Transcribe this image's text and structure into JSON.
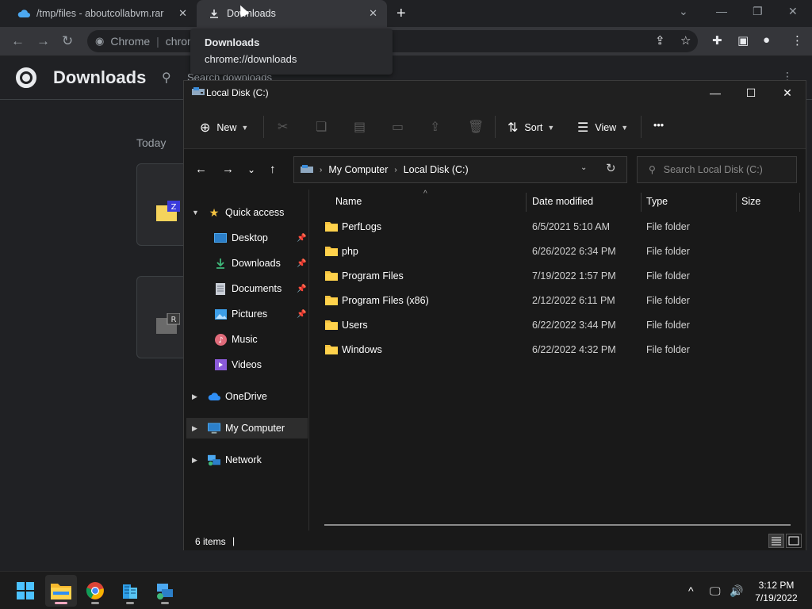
{
  "chrome": {
    "tabs": [
      {
        "label": "/tmp/files - aboutcollabvm.rar",
        "icon": "cloud-icon"
      },
      {
        "label": "Downloads",
        "icon": "download-icon"
      }
    ],
    "omnibox": {
      "site_label": "Chrome",
      "url_partial": "chrom"
    },
    "tooltip": {
      "title": "Downloads",
      "url": "chrome://downloads"
    },
    "downloads_page": {
      "title": "Downloads",
      "search_placeholder": "Search downloads",
      "section_label": "Today"
    }
  },
  "explorer": {
    "title": "Local Disk (C:)",
    "commands": {
      "new_label": "New",
      "sort_label": "Sort",
      "view_label": "View",
      "more_label": "•••"
    },
    "breadcrumb": [
      "My Computer",
      "Local Disk (C:)"
    ],
    "search_placeholder": "Search Local Disk (C:)",
    "nav": [
      {
        "label": "Quick access",
        "icon": "star-icon"
      },
      {
        "label": "Desktop",
        "icon": "desktop-icon",
        "pinned": true
      },
      {
        "label": "Downloads",
        "icon": "download-icon",
        "pinned": true
      },
      {
        "label": "Documents",
        "icon": "document-icon",
        "pinned": true
      },
      {
        "label": "Pictures",
        "icon": "pictures-icon",
        "pinned": true
      },
      {
        "label": "Music",
        "icon": "music-icon"
      },
      {
        "label": "Videos",
        "icon": "videos-icon"
      },
      {
        "label": "OneDrive",
        "icon": "cloud-icon"
      },
      {
        "label": "My Computer",
        "icon": "computer-icon",
        "selected": true
      },
      {
        "label": "Network",
        "icon": "network-icon"
      }
    ],
    "columns": [
      "Name",
      "Date modified",
      "Type",
      "Size"
    ],
    "rows": [
      {
        "name": "PerfLogs",
        "date": "6/5/2021 5:10 AM",
        "type": "File folder"
      },
      {
        "name": "php",
        "date": "6/26/2022 6:34 PM",
        "type": "File folder"
      },
      {
        "name": "Program Files",
        "date": "7/19/2022 1:57 PM",
        "type": "File folder"
      },
      {
        "name": "Program Files (x86)",
        "date": "2/12/2022 6:11 PM",
        "type": "File folder"
      },
      {
        "name": "Users",
        "date": "6/22/2022 3:44 PM",
        "type": "File folder"
      },
      {
        "name": "Windows",
        "date": "6/22/2022 4:32 PM",
        "type": "File folder"
      }
    ],
    "status": {
      "item_count": "6 items"
    }
  },
  "taskbar": {
    "apps": [
      "start-icon",
      "file-explorer-icon",
      "chrome-icon",
      "building-icon",
      "network-computer-icon"
    ],
    "clock": {
      "time": "3:12 PM",
      "date": "7/19/2022"
    }
  },
  "colors": {
    "folder": "#f5c441",
    "accent": "#4ca8f0",
    "windows_blue": "#2f8ef4"
  }
}
